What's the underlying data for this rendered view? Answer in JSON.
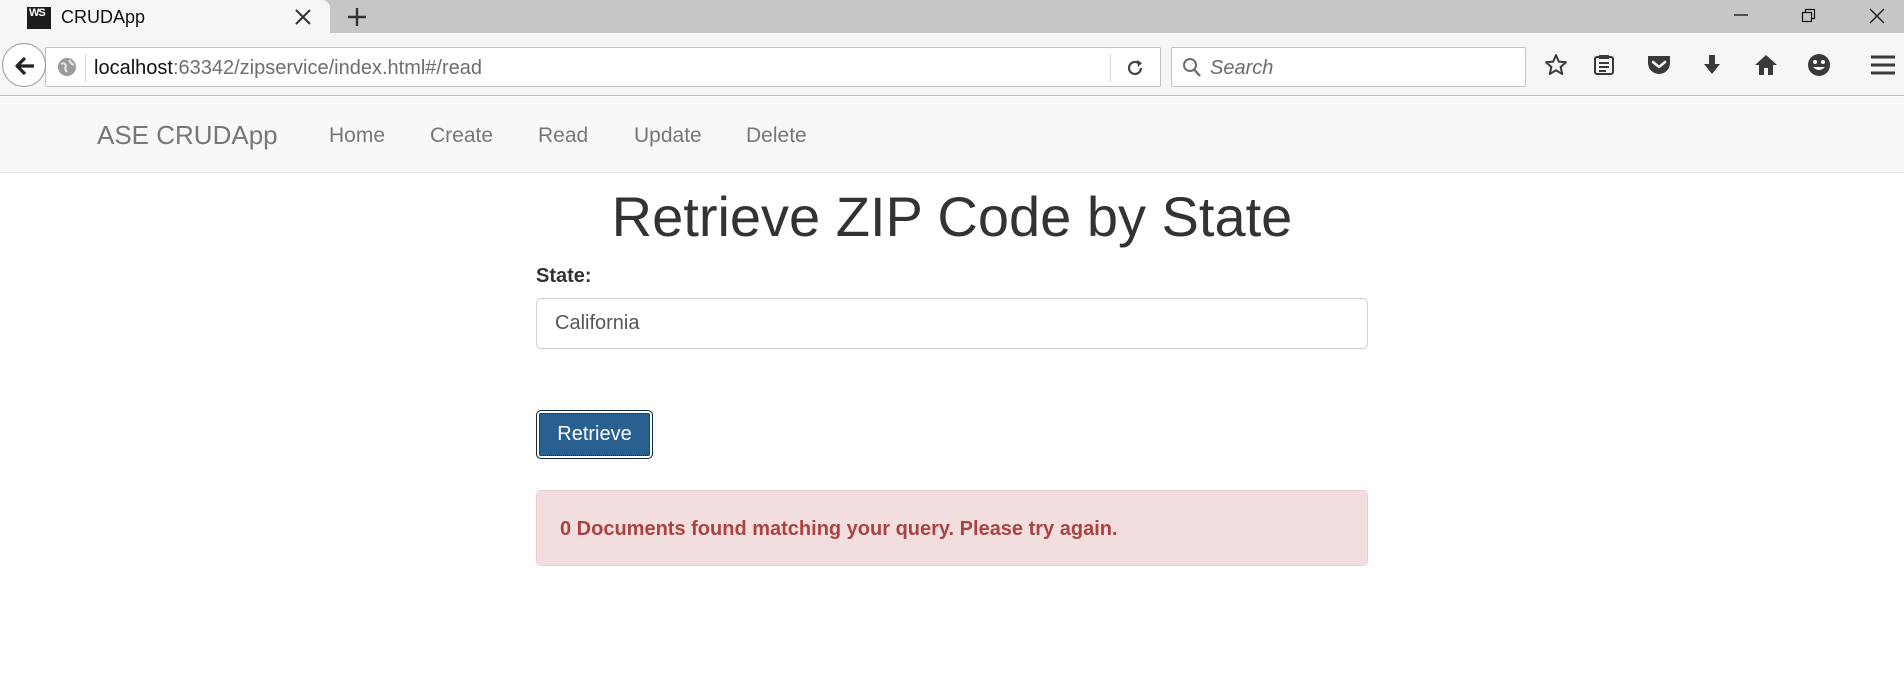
{
  "browser": {
    "tab_title": "CRUDApp",
    "favicon_text": "WS",
    "url_host": "localhost",
    "url_rest": ":63342/zipservice/index.html#/read",
    "search_placeholder": "Search"
  },
  "navbar": {
    "brand": "ASE CRUDApp",
    "items": [
      {
        "label": "Home"
      },
      {
        "label": "Create"
      },
      {
        "label": "Read"
      },
      {
        "label": "Update"
      },
      {
        "label": "Delete"
      }
    ]
  },
  "main": {
    "title": "Retrieve ZIP Code by State",
    "state_label": "State:",
    "state_value": "California",
    "retrieve_label": "Retrieve",
    "alert_text": "0 Documents found matching your query. Please try again."
  },
  "colors": {
    "primary_button": "#286090",
    "alert_bg": "#f2dede",
    "alert_text": "#a94442",
    "navbar_bg": "#f8f8f8"
  },
  "icons": [
    "close-icon",
    "plus-icon",
    "minimize-icon",
    "restore-icon",
    "window-close-icon",
    "back-arrow-icon",
    "globe-icon",
    "reload-icon",
    "search-icon",
    "bookmark-star-icon",
    "reading-list-icon",
    "pocket-icon",
    "download-icon",
    "home-icon",
    "emoji-icon",
    "menu-icon"
  ]
}
